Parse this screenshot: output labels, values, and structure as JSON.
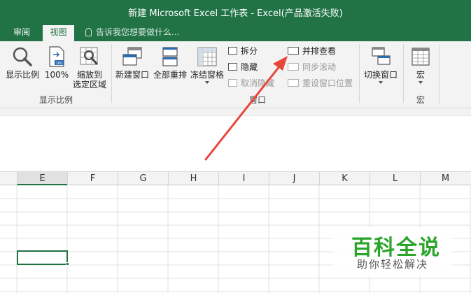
{
  "window": {
    "title": "新建 Microsoft Excel 工作表 - Excel(产品激活失败)"
  },
  "tabs": {
    "review": "审阅",
    "view": "视图"
  },
  "tellme": {
    "text": "告诉我您想要做什么..."
  },
  "ribbon": {
    "show_ratio": "显示比例",
    "zoom_100": "100%",
    "zoom_selection_line1": "缩放到",
    "zoom_selection_line2": "选定区域",
    "group_zoom": "显示比例",
    "new_window": "新建窗口",
    "arrange_all": "全部重排",
    "freeze_panes": "冻结窗格",
    "split": "拆分",
    "hide": "隐藏",
    "unhide": "取消隐藏",
    "view_side_by_side": "并排查看",
    "sync_scroll": "同步滚动",
    "reset_position": "重设窗口位置",
    "group_window": "窗口",
    "switch_windows": "切换窗口",
    "macros": "宏",
    "group_macros": "宏"
  },
  "columns": [
    "E",
    "F",
    "G",
    "H",
    "I",
    "J",
    "K",
    "L",
    "M"
  ],
  "active_column": "E",
  "watermark": {
    "brand": "百科全说",
    "slogan": "助你轻松解决"
  },
  "colors": {
    "accent": "#217346",
    "arrow": "#e8463a",
    "watermark": "#2aa52a"
  }
}
